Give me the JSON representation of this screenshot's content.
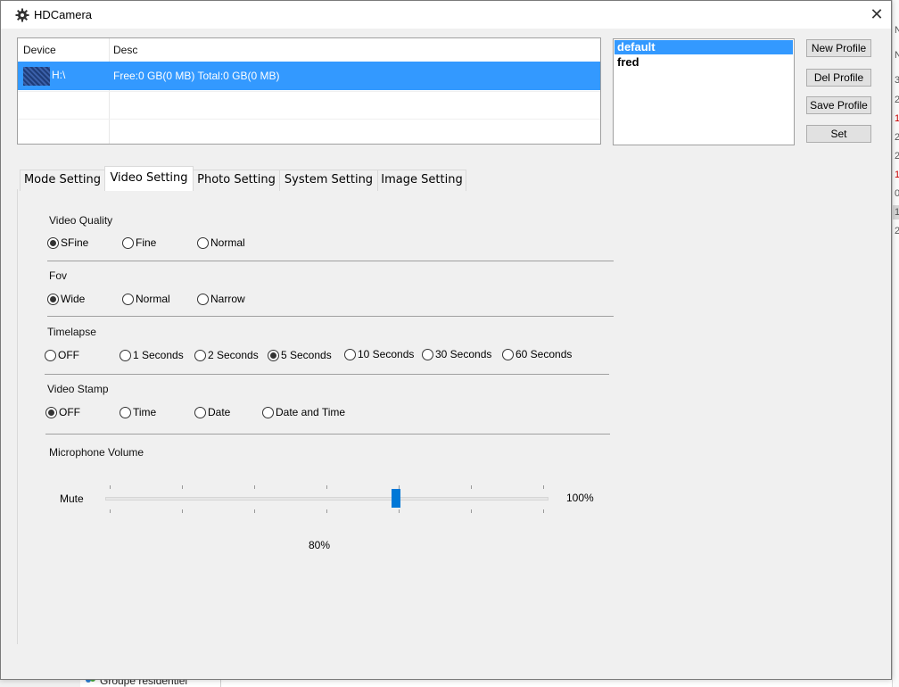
{
  "window": {
    "title": "HDCamera",
    "close_glyph": "✕"
  },
  "device_table": {
    "headers": [
      "Device",
      "Desc"
    ],
    "rows": [
      {
        "device": "H:\\",
        "desc": "Free:0 GB(0 MB) Total:0 GB(0 MB)"
      }
    ]
  },
  "profiles": {
    "items": [
      "default",
      "fred"
    ],
    "selected": "default"
  },
  "buttons": {
    "new_profile": "New Profile",
    "del_profile": "Del Profile",
    "save_profile": "Save Profile",
    "set": "Set"
  },
  "tabs": [
    {
      "label": "Mode Setting"
    },
    {
      "label": "Video Setting",
      "active": true
    },
    {
      "label": "Photo Setting"
    },
    {
      "label": "System Setting"
    },
    {
      "label": "Image Setting"
    }
  ],
  "video_quality": {
    "label": "Video Quality",
    "options": [
      "SFine",
      "Fine",
      "Normal"
    ],
    "selected": "SFine"
  },
  "fov": {
    "label": "Fov",
    "options": [
      "Wide",
      "Normal",
      "Narrow"
    ],
    "selected": "Wide"
  },
  "timelapse": {
    "label": "Timelapse",
    "options": [
      "OFF",
      "1 Seconds",
      "2 Seconds",
      "5 Seconds",
      "10 Seconds",
      "30 Seconds",
      "60 Seconds"
    ],
    "selected": "5 Seconds"
  },
  "video_stamp": {
    "label": "Video Stamp",
    "options": [
      "OFF",
      "Time",
      "Date",
      "Date and Time"
    ],
    "selected": "OFF"
  },
  "microphone": {
    "label": "Microphone Volume",
    "min_label": "Mute",
    "max_label": "100%",
    "value_label": "80%",
    "value_fraction": 0.66
  },
  "background": {
    "right_digits": [
      "N",
      "3",
      "2",
      "1",
      "2",
      "2",
      "1",
      "0",
      "1",
      "2"
    ],
    "bottom_item": "Groupe résidentiel"
  },
  "colors": {
    "selection": "#3399ff",
    "slider_thumb": "#0078d7"
  }
}
